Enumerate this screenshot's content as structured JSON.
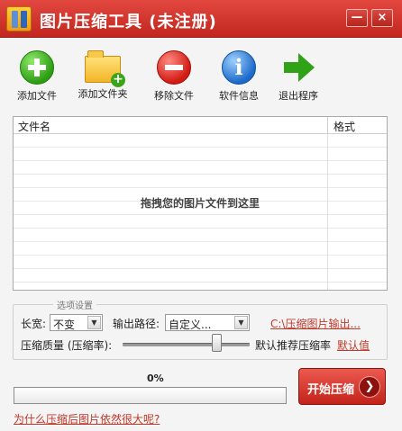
{
  "window": {
    "title": "图片压缩工具 (未注册)",
    "minimize_glyph": "—",
    "close_glyph": "×"
  },
  "toolbar": [
    {
      "label": "添加文件",
      "icon": "add-circle-icon"
    },
    {
      "label": "添加文件夹",
      "icon": "folder-add-icon"
    },
    {
      "label": "移除文件",
      "icon": "remove-circle-icon"
    },
    {
      "label": "软件信息",
      "icon": "info-icon"
    },
    {
      "label": "退出程序",
      "icon": "arrow-right-icon"
    }
  ],
  "file_list": {
    "columns": [
      "文件名",
      "格式"
    ],
    "drop_hint": "拖拽您的图片文件到这里"
  },
  "options": {
    "group_title": "选项设置",
    "size_label": "长宽:",
    "size_value": "不变",
    "output_path_label": "输出路径:",
    "output_path_value": "自定义...",
    "output_path_link": "C:\\压缩图片输出...",
    "quality_label": "压缩质量 (压缩率):",
    "quality_level": 0.76,
    "recommended_label": "默认推荐压缩率",
    "default_link": "默认值"
  },
  "progress": {
    "percent_text": "0%",
    "fraction": 0
  },
  "start_button": {
    "label": "开始压缩"
  },
  "help_link": "为什么压缩后图片依然很大呢?",
  "colors": {
    "titlebar": "#c2271f",
    "link": "#c0392b",
    "start_button": "#d23a30"
  }
}
